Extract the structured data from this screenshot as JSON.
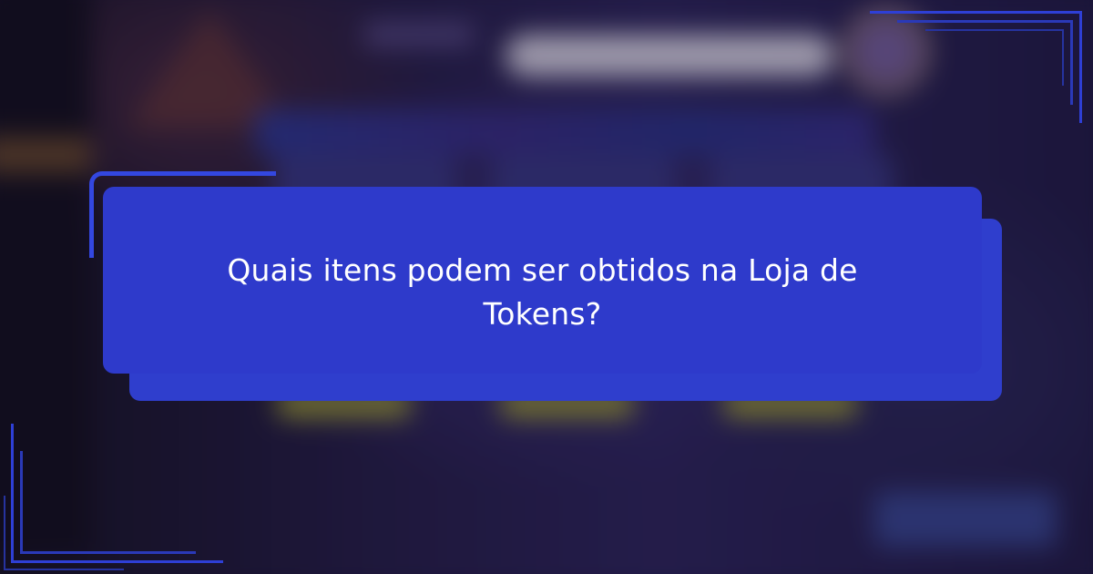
{
  "question": {
    "text": "Quais itens podem ser obtidos na Loja de Tokens?"
  },
  "colors": {
    "card": "#2e3acb",
    "card_back": "#2f3ecd",
    "frame_lines": "#2e3fd6",
    "text": "#ffffff"
  },
  "background": {
    "description_icons": [
      "search-bar",
      "avatar-icon",
      "nav-bar",
      "action-buttons"
    ]
  }
}
